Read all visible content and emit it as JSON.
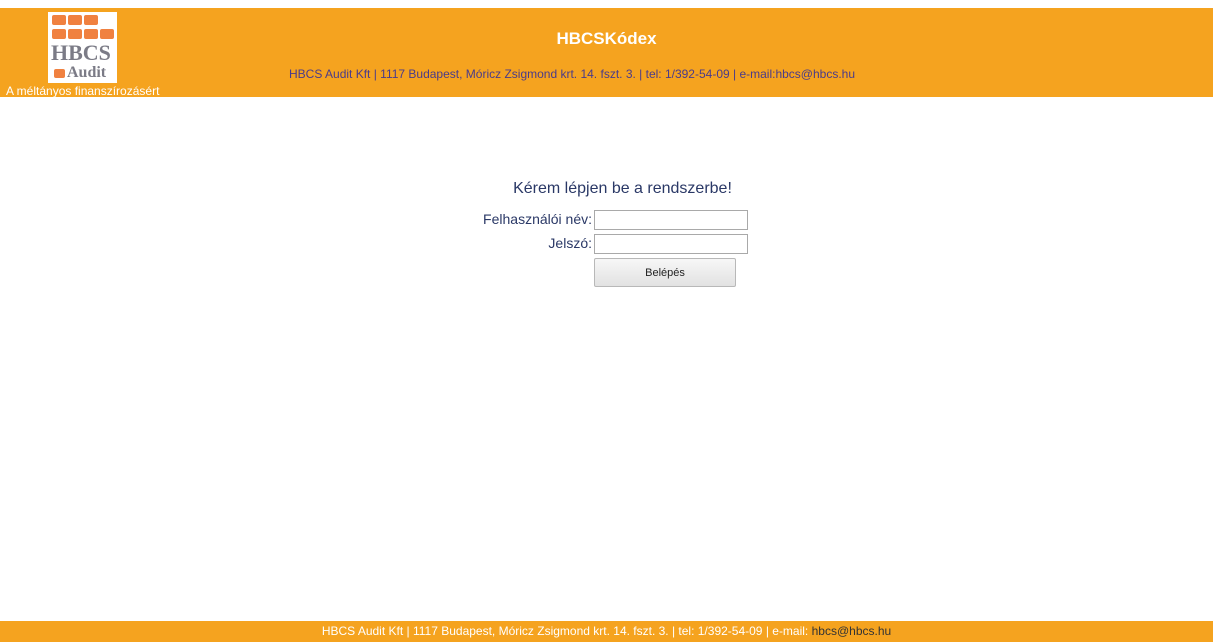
{
  "header": {
    "logo": {
      "name": "HBCS Audit logo",
      "line1": "HBCS",
      "line2": "Audit",
      "square_colors": [
        "#f08140",
        "#f08140",
        "#f08140",
        "#f08140",
        "#f08140",
        "#f08140",
        "#f08140"
      ]
    },
    "tagline": "A méltányos finanszírozásért",
    "app_title": "HBCSKódex",
    "info": "HBCS Audit Kft | 1117 Budapest, Móricz Zsigmond krt. 14. fszt. 3. | tel: 1/392-54-09 | e-mail:hbcs@hbcs.hu"
  },
  "login": {
    "heading": "Kérem lépjen be a rendszerbe!",
    "username_label": "Felhasználói név:",
    "username_value": "",
    "password_label": "Jelszó:",
    "password_value": "",
    "submit_label": "Belépés"
  },
  "footer": {
    "text": "HBCS Audit Kft | 1117 Budapest, Móricz Zsigmond krt. 14. fszt. 3. | tel: 1/392-54-09 | e-mail: ",
    "email": "hbcs@hbcs.hu"
  },
  "colors": {
    "brand_orange": "#f5a31f",
    "logo_orange": "#f08140",
    "text_navy": "#2a3866"
  }
}
